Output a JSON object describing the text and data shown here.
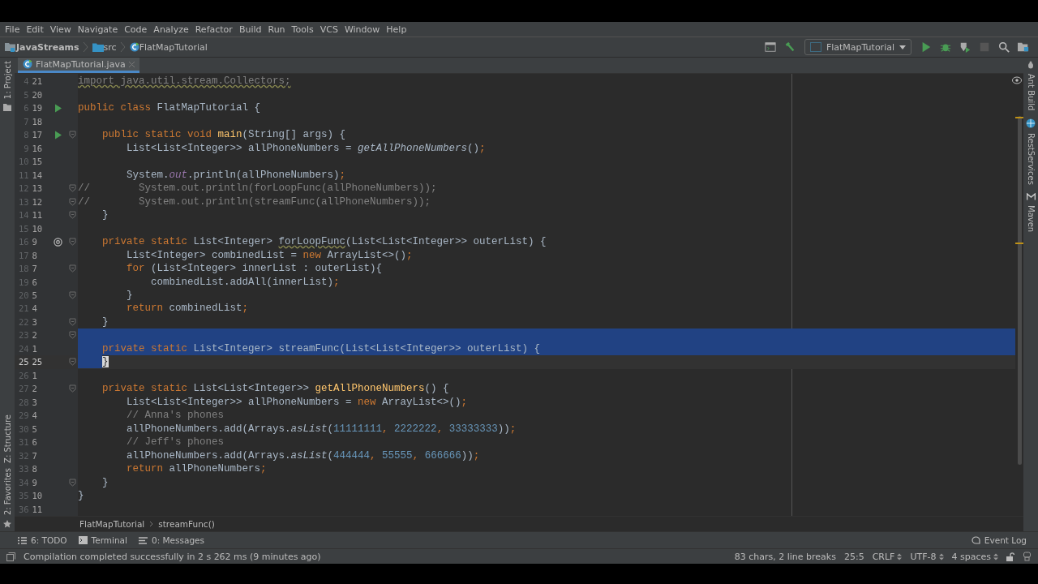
{
  "menu": [
    "File",
    "Edit",
    "View",
    "Navigate",
    "Code",
    "Analyze",
    "Refactor",
    "Build",
    "Run",
    "Tools",
    "VCS",
    "Window",
    "Help"
  ],
  "breadcrumbs": [
    {
      "label": "JavaStreams",
      "kind": "module"
    },
    {
      "label": "src",
      "kind": "folder"
    },
    {
      "label": "FlatMapTutorial",
      "kind": "class"
    }
  ],
  "run_config": "FlatMapTutorial",
  "tabs": [
    {
      "label": "FlatMapTutorial.java",
      "selected": true
    }
  ],
  "left_tools_top": [
    "1: Project"
  ],
  "left_tools_bottom": [
    "Z: Structure",
    "2: Favorites"
  ],
  "right_tools": [
    {
      "label": "Ant Build",
      "kind": "ant"
    },
    {
      "label": "RestServices",
      "kind": "rest"
    },
    {
      "label": "Maven",
      "kind": "maven"
    }
  ],
  "code": [
    {
      "num": "4",
      "rel": "21",
      "tokens": [
        {
          "text": "import java.util.stream.Collectors;",
          "kind": "unused"
        }
      ]
    },
    {
      "num": "5",
      "rel": "20"
    },
    {
      "num": "6",
      "rel": "19",
      "runnable": true,
      "tokens": [
        {
          "text": "public class ",
          "kind": "keyword"
        },
        {
          "text": "FlatMapTutorial {",
          "kind": "plain"
        }
      ]
    },
    {
      "num": "7",
      "rel": "18"
    },
    {
      "num": "8",
      "rel": "17",
      "runnable": true,
      "fold": true,
      "tokens": [
        {
          "text": "    public static void ",
          "kind": "keyword"
        },
        {
          "text": "main",
          "kind": "declaration"
        },
        {
          "text": "(String[] args) {",
          "kind": "plain"
        }
      ]
    },
    {
      "num": "9",
      "rel": "16",
      "tokens": [
        {
          "text": "        List<List<Integer>> allPhoneNumbers = ",
          "kind": "plain"
        },
        {
          "text": "getAllPhoneNumbers",
          "kind": "static"
        },
        {
          "text": "()",
          "kind": "plain"
        },
        {
          "text": ";",
          "kind": "keyword"
        }
      ]
    },
    {
      "num": "10",
      "rel": "15"
    },
    {
      "num": "11",
      "rel": "14",
      "tokens": [
        {
          "text": "        System.",
          "kind": "plain"
        },
        {
          "text": "out",
          "kind": "field"
        },
        {
          "text": ".println(allPhoneNumbers)",
          "kind": "plain"
        },
        {
          "text": ";",
          "kind": "keyword"
        }
      ]
    },
    {
      "num": "12",
      "rel": "13",
      "fold": true,
      "tokens": [
        {
          "text": "//        System.out.println(forLoopFunc(allPhoneNumbers));",
          "kind": "comment"
        }
      ]
    },
    {
      "num": "13",
      "rel": "12",
      "fold": true,
      "tokens": [
        {
          "text": "//        System.out.println(streamFunc(allPhoneNumbers));",
          "kind": "comment"
        }
      ]
    },
    {
      "num": "14",
      "rel": "11",
      "fold": true,
      "tokens": [
        {
          "text": "    }",
          "kind": "plain"
        }
      ]
    },
    {
      "num": "15",
      "rel": "10"
    },
    {
      "num": "16",
      "rel": "9",
      "overrides": true,
      "fold": true,
      "tokens": [
        {
          "text": "    private static ",
          "kind": "keyword"
        },
        {
          "text": "List<Integer> ",
          "kind": "plain"
        },
        {
          "text": "forLoopFunc",
          "kind": "warning"
        },
        {
          "text": "(List<List<Integer>> outerList) {",
          "kind": "plain"
        }
      ]
    },
    {
      "num": "17",
      "rel": "8",
      "tokens": [
        {
          "text": "        List<Integer> combinedList = ",
          "kind": "plain"
        },
        {
          "text": "new ",
          "kind": "keyword"
        },
        {
          "text": "ArrayList<>()",
          "kind": "plain"
        },
        {
          "text": ";",
          "kind": "keyword"
        }
      ]
    },
    {
      "num": "18",
      "rel": "7",
      "fold": true,
      "tokens": [
        {
          "text": "        for ",
          "kind": "keyword"
        },
        {
          "text": "(List<Integer> innerList : outerList){",
          "kind": "plain"
        }
      ]
    },
    {
      "num": "19",
      "rel": "6",
      "tokens": [
        {
          "text": "            combinedList.addAll(innerList)",
          "kind": "plain"
        },
        {
          "text": ";",
          "kind": "keyword"
        }
      ]
    },
    {
      "num": "20",
      "rel": "5",
      "fold": true,
      "tokens": [
        {
          "text": "        }",
          "kind": "plain"
        }
      ]
    },
    {
      "num": "21",
      "rel": "4",
      "tokens": [
        {
          "text": "        return ",
          "kind": "keyword"
        },
        {
          "text": "combinedList",
          "kind": "plain"
        },
        {
          "text": ";",
          "kind": "keyword"
        }
      ]
    },
    {
      "num": "22",
      "rel": "3",
      "fold": true,
      "tokens": [
        {
          "text": "    }",
          "kind": "plain"
        }
      ]
    },
    {
      "num": "23",
      "rel": "2",
      "fold": true,
      "selected": true
    },
    {
      "num": "24",
      "rel": "1",
      "selected": true,
      "tokens": [
        {
          "text": "    private static ",
          "kind": "keyword"
        },
        {
          "text": "List<Integer> streamFunc(List<List<Integer>> outerList) {",
          "kind": "plain"
        }
      ]
    },
    {
      "num": "25",
      "rel": "25",
      "fold": true,
      "current": true,
      "selected": true,
      "tokens": [
        {
          "text": "}",
          "kind": "brace"
        }
      ]
    },
    {
      "num": "26",
      "rel": "1"
    },
    {
      "num": "27",
      "rel": "2",
      "fold": true,
      "tokens": [
        {
          "text": "    private static ",
          "kind": "keyword"
        },
        {
          "text": "List<List<Integer>> ",
          "kind": "plain"
        },
        {
          "text": "getAllPhoneNumbers",
          "kind": "declaration"
        },
        {
          "text": "() {",
          "kind": "plain"
        }
      ]
    },
    {
      "num": "28",
      "rel": "3",
      "tokens": [
        {
          "text": "        List<List<Integer>> allPhoneNumbers = ",
          "kind": "plain"
        },
        {
          "text": "new ",
          "kind": "keyword"
        },
        {
          "text": "ArrayList<>()",
          "kind": "plain"
        },
        {
          "text": ";",
          "kind": "keyword"
        }
      ]
    },
    {
      "num": "29",
      "rel": "4",
      "tokens": [
        {
          "text": "        // Anna's phones",
          "kind": "comment"
        }
      ]
    },
    {
      "num": "30",
      "rel": "5",
      "tokens": [
        {
          "text": "        allPhoneNumbers.add(Arrays.",
          "kind": "plain"
        },
        {
          "text": "asList",
          "kind": "static"
        },
        {
          "text": "(",
          "kind": "plain"
        },
        {
          "text": "11111111",
          "kind": "number"
        },
        {
          "text": ", ",
          "kind": "keyword"
        },
        {
          "text": "2222222",
          "kind": "number"
        },
        {
          "text": ", ",
          "kind": "keyword"
        },
        {
          "text": "33333333",
          "kind": "number"
        },
        {
          "text": "))",
          "kind": "plain"
        },
        {
          "text": ";",
          "kind": "keyword"
        }
      ]
    },
    {
      "num": "31",
      "rel": "6",
      "tokens": [
        {
          "text": "        // Jeff's phones",
          "kind": "comment"
        }
      ]
    },
    {
      "num": "32",
      "rel": "7",
      "tokens": [
        {
          "text": "        allPhoneNumbers.add(Arrays.",
          "kind": "plain"
        },
        {
          "text": "asList",
          "kind": "static"
        },
        {
          "text": "(",
          "kind": "plain"
        },
        {
          "text": "444444",
          "kind": "number"
        },
        {
          "text": ", ",
          "kind": "keyword"
        },
        {
          "text": "55555",
          "kind": "number"
        },
        {
          "text": ", ",
          "kind": "keyword"
        },
        {
          "text": "666666",
          "kind": "number"
        },
        {
          "text": "))",
          "kind": "plain"
        },
        {
          "text": ";",
          "kind": "keyword"
        }
      ]
    },
    {
      "num": "33",
      "rel": "8",
      "tokens": [
        {
          "text": "        return ",
          "kind": "keyword"
        },
        {
          "text": "allPhoneNumbers",
          "kind": "plain"
        },
        {
          "text": ";",
          "kind": "keyword"
        }
      ]
    },
    {
      "num": "34",
      "rel": "9",
      "fold": true,
      "tokens": [
        {
          "text": "    }",
          "kind": "plain"
        }
      ]
    },
    {
      "num": "35",
      "rel": "10",
      "tokens": [
        {
          "text": "}",
          "kind": "plain"
        }
      ]
    },
    {
      "num": "36",
      "rel": "11"
    }
  ],
  "footer_breadcrumbs": [
    "FlatMapTutorial",
    "streamFunc()"
  ],
  "tool_tabs": [
    {
      "label": "6: TODO",
      "kind": "todo"
    },
    {
      "label": "Terminal",
      "kind": "terminal"
    },
    {
      "label": "0: Messages",
      "kind": "messages"
    }
  ],
  "event_log": "Event Log",
  "status": {
    "message": "Compilation completed successfully in 2 s 262 ms (9 minutes ago)",
    "selection_info": "83 chars, 2 line breaks",
    "caret": "25:5",
    "line_separator": "CRLF",
    "encoding": "UTF-8",
    "indent": "4 spaces"
  }
}
